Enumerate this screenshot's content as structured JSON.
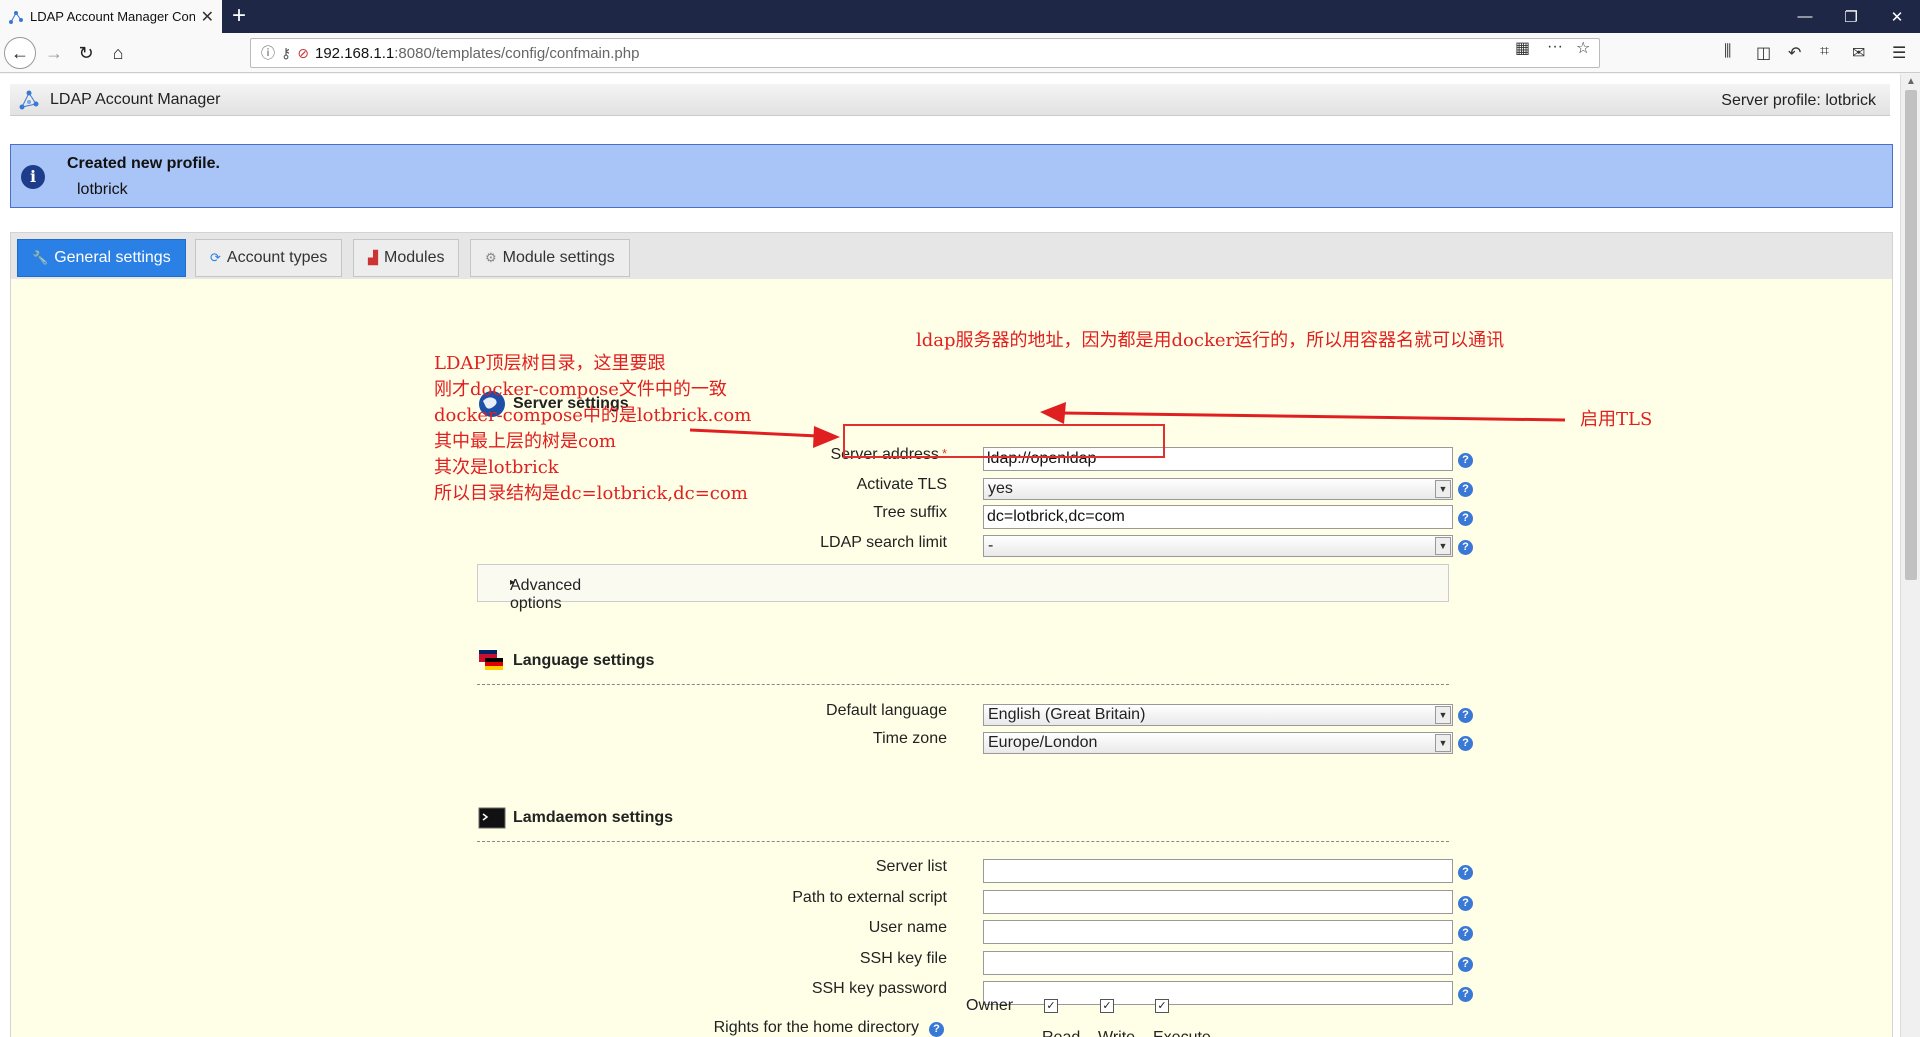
{
  "browser": {
    "tab_title": "LDAP Account Manager Con",
    "url_host": "192.168.1.1",
    "url_path": ":8080/templates/config/confmain.php"
  },
  "header": {
    "app_title": "LDAP Account Manager",
    "server_profile": "Server profile: lotbrick"
  },
  "notice": {
    "title": "Created new profile.",
    "text": "lotbrick"
  },
  "tabs": [
    {
      "label": "General settings",
      "active": true
    },
    {
      "label": "Account types",
      "active": false
    },
    {
      "label": "Modules",
      "active": false
    },
    {
      "label": "Module settings",
      "active": false
    }
  ],
  "server_settings": {
    "title": "Server settings",
    "server_address_label": "Server address",
    "server_address_value": "ldap://openldap",
    "activate_tls_label": "Activate TLS",
    "activate_tls_value": "yes",
    "tree_suffix_label": "Tree suffix",
    "tree_suffix_value": "dc=lotbrick,dc=com",
    "search_limit_label": "LDAP search limit",
    "search_limit_value": "-",
    "advanced_label": "Advanced options"
  },
  "language_settings": {
    "title": "Language settings",
    "default_language_label": "Default language",
    "default_language_value": "English (Great Britain)",
    "time_zone_label": "Time zone",
    "time_zone_value": "Europe/London"
  },
  "lamdaemon_settings": {
    "title": "Lamdaemon settings",
    "server_list_label": "Server list",
    "external_script_label": "Path to external script",
    "user_name_label": "User name",
    "ssh_key_file_label": "SSH key file",
    "ssh_key_password_label": "SSH key password",
    "rights_label": "Rights for the home directory",
    "col_read": "Read",
    "col_write": "Write",
    "col_execute": "Execute",
    "owner_label": "Owner",
    "owner_read": true,
    "owner_write": true,
    "owner_execute": true
  },
  "annotations": {
    "server_note": "ldap服务器的地址，因为都是用docker运行的，所以用容器名就可以通讯",
    "tls_note": "启用TLS",
    "tree_note_1": "LDAP顶层树目录，这里要跟",
    "tree_note_2": "刚才docker-compose文件中的一致",
    "tree_note_3": "docker-compose中的是lotbrick.com",
    "tree_note_4": "其中最上层的树是com",
    "tree_note_5": "其次是lotbrick",
    "tree_note_6": "所以目录结构是dc=lotbrick,dc=com"
  },
  "colors": {
    "accent_tab": "#2a80e4",
    "info_bg": "#a9c4f6",
    "content_bg": "#ffffe8",
    "annotation": "#e02020"
  }
}
